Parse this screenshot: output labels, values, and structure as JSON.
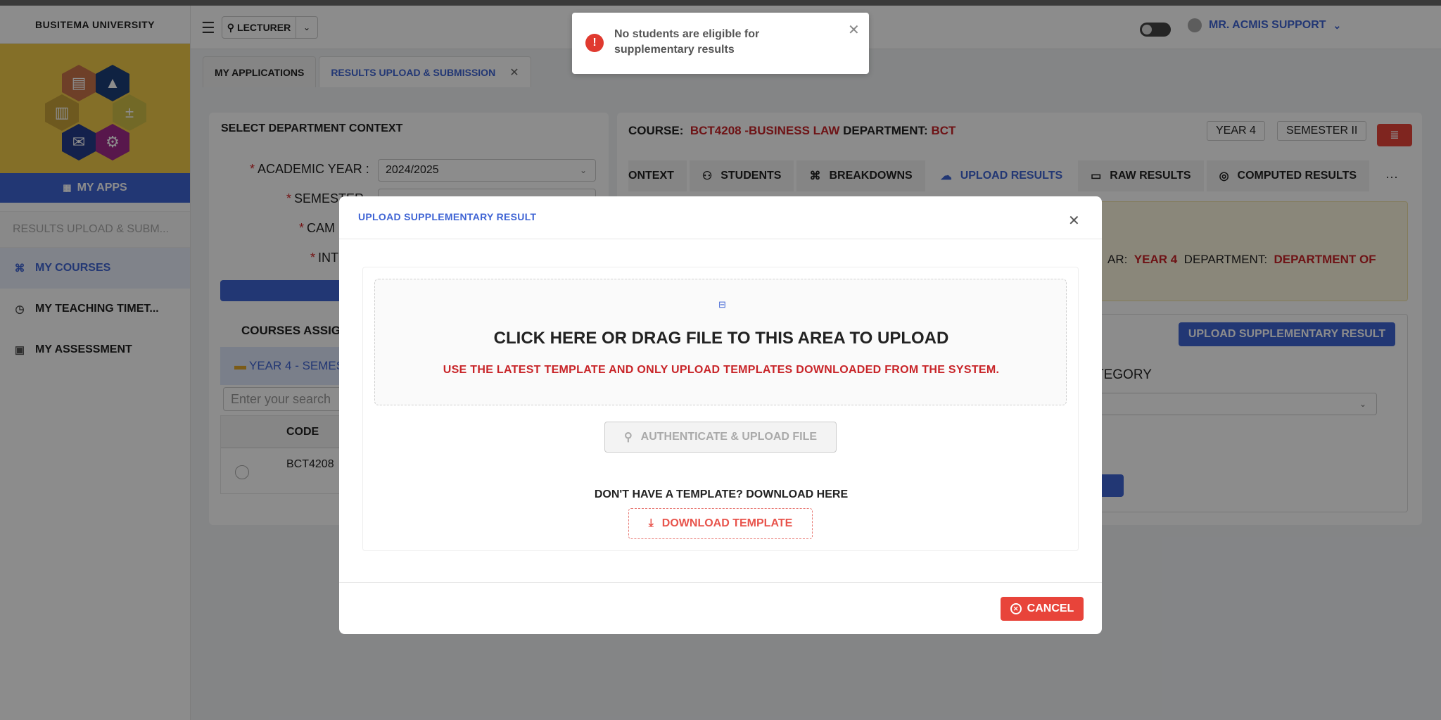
{
  "sidebar": {
    "university": "BUSITEMA UNIVERSITY",
    "my_apps": "MY APPS",
    "search_placeholder": "RESULTS UPLOAD & SUBM...",
    "items": [
      {
        "label": "MY COURSES",
        "icon": "sitemap-icon",
        "active": true
      },
      {
        "label": "MY TEACHING TIMET...",
        "icon": "clock-icon",
        "active": false
      },
      {
        "label": "MY ASSESSMENT",
        "icon": "assessment-icon",
        "active": false
      }
    ]
  },
  "header": {
    "role": "LECTURER",
    "user": "MR. ACMIS SUPPORT"
  },
  "tabs": [
    {
      "label": "MY APPLICATIONS"
    },
    {
      "label": "RESULTS UPLOAD & SUBMISSION"
    }
  ],
  "left_panel": {
    "title": "SELECT DEPARTMENT CONTEXT",
    "academic_year_label": "ACADEMIC YEAR",
    "academic_year_value": "2024/2025",
    "semester_label": "SEMESTER",
    "campus_label": "CAM",
    "intake_label": "INT",
    "courses_title": "COURSES ASSIG",
    "year_group": "YEAR 4 - SEMEST",
    "search_placeholder": "Enter your search",
    "code_header": "CODE",
    "row_code": "BCT4208"
  },
  "right_panel": {
    "course_label": "COURSE:",
    "course_value": "BCT4208 -BUSINESS LAW",
    "department_label": "DEPARTMENT:",
    "department_value": "BCT",
    "year_chip": "YEAR 4",
    "semester_chip": "SEMESTER II",
    "tabs": [
      "ONTEXT",
      "STUDENTS",
      "BREAKDOWNS",
      "UPLOAD RESULTS",
      "RAW RESULTS",
      "COMPUTED RESULTS"
    ],
    "info_ar_label": "AR:",
    "info_year": "YEAR 4",
    "info_dept_label": "DEPARTMENT:",
    "info_dept": "DEPARTMENT OF",
    "upload_supp_button": "UPLOAD SUPPLEMENTARY RESULT",
    "category_label": "TEGORY"
  },
  "modal": {
    "title": "UPLOAD SUPPLEMENTARY RESULT",
    "drop_title": "CLICK HERE OR DRAG FILE TO THIS AREA TO UPLOAD",
    "drop_subtitle": "USE THE LATEST TEMPLATE AND ONLY UPLOAD TEMPLATES DOWNLOADED FROM THE SYSTEM.",
    "auth_button": "AUTHENTICATE & UPLOAD FILE",
    "template_question": "DON'T HAVE A TEMPLATE? DOWNLOAD HERE",
    "download_button": "DOWNLOAD TEMPLATE",
    "cancel_button": "CANCEL"
  },
  "toast": {
    "message": "No students are eligible for supplementary results"
  },
  "colors": {
    "primary": "#3f64d4",
    "danger": "#e8443a",
    "logo_bg": "#f1cb49"
  }
}
